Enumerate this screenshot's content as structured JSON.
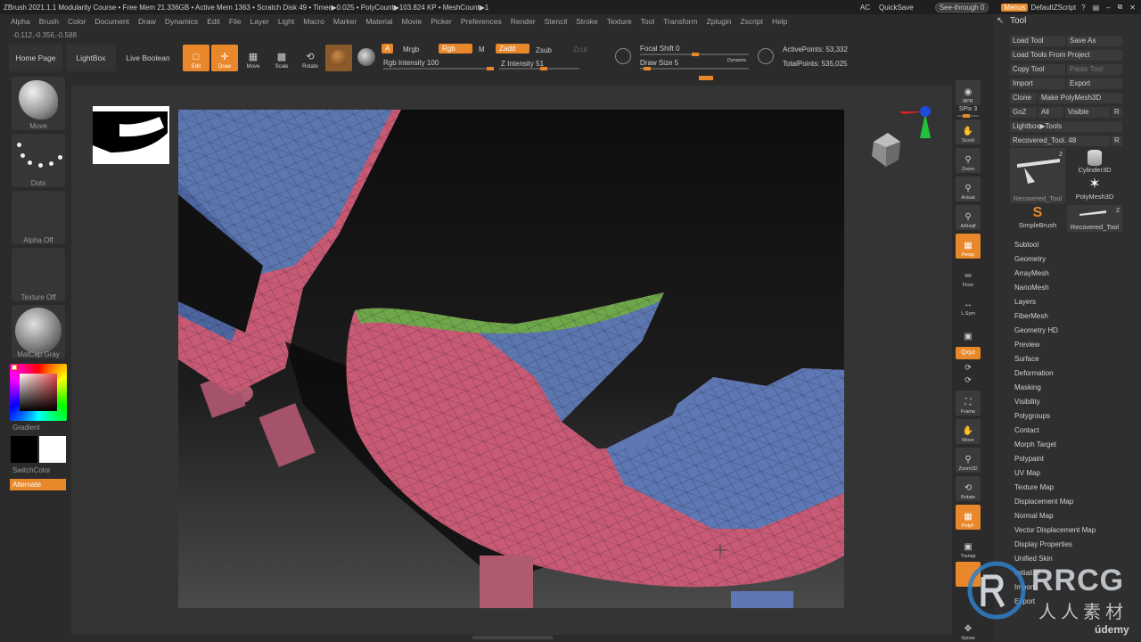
{
  "titlebar": {
    "left": "ZBrush 2021.1.1   Modularity Course  • Free Mem 21.336GB • Active Mem 1363 • Scratch Disk 49 •  Timer▶0.025 • PolyCount▶103.824 KP  • MeshCount▶1",
    "ac": "AC",
    "quicksave": "QuickSave",
    "see_through": "See-through  0",
    "menus": "Menus",
    "default_script": "DefaultZScript"
  },
  "menus": [
    "Alpha",
    "Brush",
    "Color",
    "Document",
    "Draw",
    "Dynamics",
    "Edit",
    "File",
    "Layer",
    "Light",
    "Macro",
    "Marker",
    "Material",
    "Movie",
    "Picker",
    "Preferences",
    "Render",
    "Stencil",
    "Stroke",
    "Texture",
    "Tool",
    "Transform",
    "Zplugin",
    "Zscript",
    "Help"
  ],
  "coords": "-0.112,-0.356,-0.588",
  "shelf": {
    "home_page": "Home Page",
    "lightbox": "LightBox",
    "live_boolean": "Live Boolean",
    "edit": "Edit",
    "draw": "Draw",
    "move": "Move",
    "scale": "Scale",
    "rotate": "Rotate",
    "a": "A",
    "mrgb": "Mrgb",
    "rgb": "Rgb",
    "m": "M",
    "zadd": "Zadd",
    "zsub": "Zsub",
    "zcut": "Zcut",
    "rgb_intensity": "Rgb Intensity 100",
    "z_intensity": "Z Intensity 51",
    "focal_shift": "Focal Shift 0",
    "draw_size": "Draw Size 5",
    "dynamic": "Dynamic",
    "active_points": "ActivePoints: 53,332",
    "total_points": "TotalPoints: 535,025"
  },
  "left_panel": {
    "brush": "Move",
    "stroke": "Dots",
    "alpha": "Alpha Off",
    "texture": "Texture Off",
    "material": "MatCap Gray",
    "gradient": "Gradient",
    "switch_color": "SwitchColor",
    "alternate": "Alternate"
  },
  "right_strip": {
    "bpr": "BPR",
    "spix": "SPix 3",
    "scroll": "Scroll",
    "zoom": "Zoom",
    "actual": "Actual",
    "aahalf": "AAHalf",
    "persp": "Persp",
    "floor": "Floor",
    "lsym": "L.Sym",
    "xyz": "Qxyz",
    "frame": "Frame",
    "move": "Move",
    "zoom3d": "Zoom3D",
    "rotate": "Rotate",
    "polyf": "PolyF",
    "transp": "Transp",
    "xpose": "Xpose"
  },
  "tool_panel": {
    "title": "Tool",
    "load_tool": "Load Tool",
    "save_as": "Save As",
    "load_from_project": "Load Tools From Project",
    "copy_tool": "Copy Tool",
    "paste_tool": "Paste Tool",
    "import": "Import",
    "export": "Export",
    "clone": "Clone",
    "make_polymesh": "Make PolyMesh3D",
    "goz": "GoZ",
    "all": "All",
    "visible": "Visible",
    "r": "R",
    "lightbox_tools": "Lightbox▶Tools",
    "recovered_slider": "Recovered_Tool. 48",
    "thumbs": [
      {
        "label": "Recovered_Tool",
        "count": "2"
      },
      {
        "label": "Cylinder3D",
        "count": ""
      },
      {
        "label": "PolyMesh3D",
        "count": ""
      },
      {
        "label": "SimpleBrush",
        "count": ""
      },
      {
        "label": "Recovered_Tool",
        "count": "2"
      }
    ],
    "subpalettes": [
      "Subtool",
      "Geometry",
      "ArrayMesh",
      "NanoMesh",
      "Layers",
      "FiberMesh",
      "Geometry HD",
      "Preview",
      "Surface",
      "Deformation",
      "Masking",
      "Visibility",
      "Polygroups",
      "Contact",
      "Morph Target",
      "Polypaint",
      "UV Map",
      "Texture Map",
      "Displacement Map",
      "Normal Map",
      "Vector Displacement Map",
      "Display Properties",
      "Unified Skin",
      "Initialize",
      "Import",
      "Export"
    ]
  },
  "watermark": {
    "brand": "RRCG",
    "sub": "人人素材"
  },
  "udemy": "údemy"
}
